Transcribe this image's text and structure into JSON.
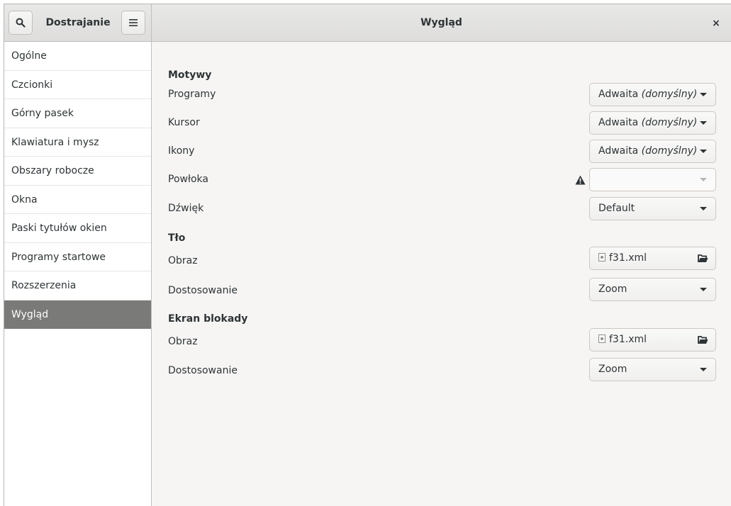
{
  "header": {
    "app_title": "Dostrajanie",
    "page_title": "Wygląd",
    "close_glyph": "×",
    "search_icon": "search-icon",
    "menu_icon": "hamburger-menu-icon"
  },
  "sidebar": {
    "items": [
      {
        "label": "Ogólne"
      },
      {
        "label": "Czcionki"
      },
      {
        "label": "Górny pasek"
      },
      {
        "label": "Klawiatura i mysz"
      },
      {
        "label": "Obszary robocze"
      },
      {
        "label": "Okna"
      },
      {
        "label": "Paski tytułów okien"
      },
      {
        "label": "Programy startowe"
      },
      {
        "label": "Rozszerzenia"
      },
      {
        "label": "Wygląd"
      }
    ],
    "selected": "Wygląd"
  },
  "themes": {
    "title": "Motywy",
    "programs": {
      "label": "Programy",
      "value": "Adwaita",
      "suffix": "(domyślny)"
    },
    "cursor": {
      "label": "Kursor",
      "value": "Adwaita",
      "suffix": "(domyślny)"
    },
    "icons": {
      "label": "Ikony",
      "value": "Adwaita",
      "suffix": "(domyślny)"
    },
    "shell": {
      "label": "Powłoka",
      "value": "",
      "warning_icon": "warning-icon"
    },
    "sound": {
      "label": "Dźwięk",
      "value": "Default"
    }
  },
  "background": {
    "title": "Tło",
    "image": {
      "label": "Obraz",
      "file": "f31.xml"
    },
    "adjustment": {
      "label": "Dostosowanie",
      "value": "Zoom"
    }
  },
  "lockscreen": {
    "title": "Ekran blokady",
    "image": {
      "label": "Obraz",
      "file": "f31.xml"
    },
    "adjustment": {
      "label": "Dostosowanie",
      "value": "Zoom"
    }
  },
  "colors": {
    "selected_bg": "#7a7a79",
    "window_bg": "#f6f5f4",
    "sidebar_bg": "#ffffff"
  }
}
